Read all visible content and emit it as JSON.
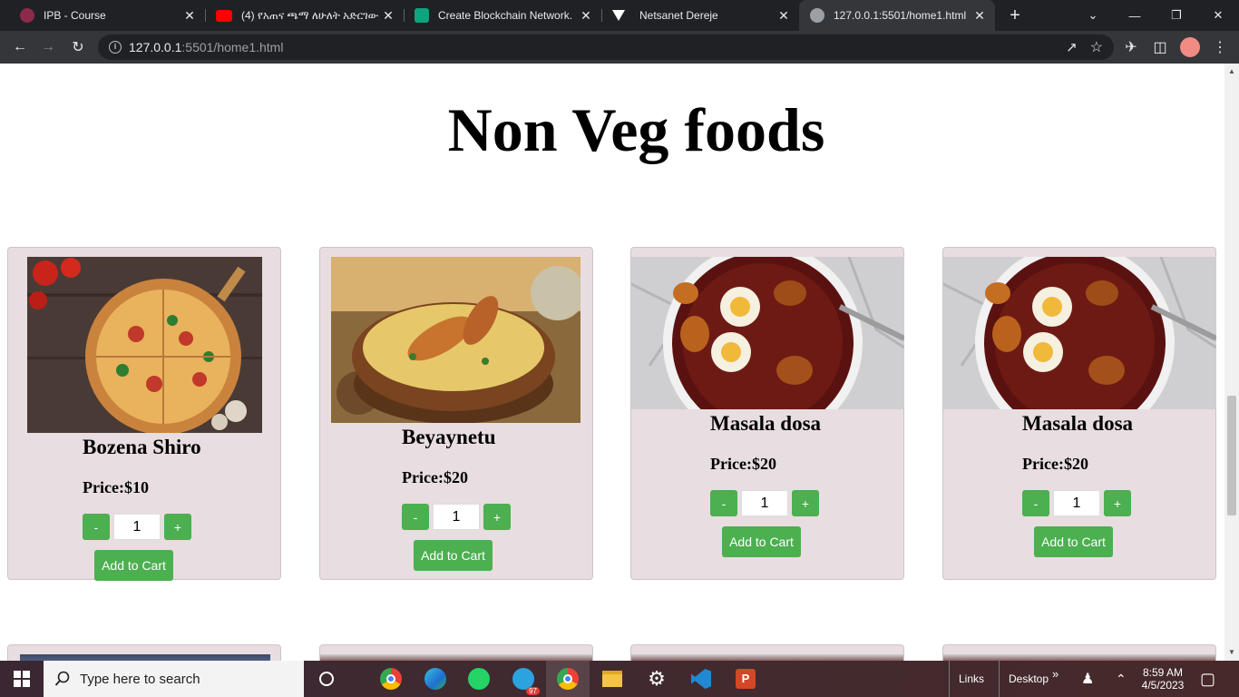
{
  "browser": {
    "tabs": [
      {
        "title": "IPB - Course",
        "icon": "ipb-logo-icon",
        "color": "#8b2a4a",
        "close": "✕"
      },
      {
        "title": "(4) የአጠና ጫማ ለሁለት አድርገው",
        "icon": "youtube-icon",
        "color": "#ff0000",
        "close": "✕"
      },
      {
        "title": "Create Blockchain Network.",
        "icon": "chatgpt-icon",
        "color": "#10a37f",
        "close": "✕"
      },
      {
        "title": "Netsanet Dereje",
        "icon": "vercel-icon",
        "color": "#ffffff",
        "close": "✕"
      },
      {
        "title": "127.0.0.1:5501/home1.html",
        "icon": "globe-icon",
        "color": "#9aa0a6",
        "close": "✕"
      }
    ],
    "new_tab": "+",
    "url_host": "127.0.0.1",
    "url_rest": ":5501/home1.html"
  },
  "page": {
    "heading": "Non Veg foods",
    "products": [
      {
        "name": "Bozena Shiro",
        "price": "Price:$10",
        "qty": "1",
        "minus": "-",
        "plus": "+",
        "cart": "Add to Cart",
        "image": "pizza-image"
      },
      {
        "name": "Beyaynetu",
        "price": "Price:$20",
        "qty": "1",
        "minus": "-",
        "plus": "+",
        "cart": "Add to Cart",
        "image": "biryani-image"
      },
      {
        "name": "Masala dosa",
        "price": "Price:$20",
        "qty": "1",
        "minus": "-",
        "plus": "+",
        "cart": "Add to Cart",
        "image": "doro-wat-image"
      },
      {
        "name": "Masala dosa",
        "price": "Price:$20",
        "qty": "1",
        "minus": "-",
        "plus": "+",
        "cart": "Add to Cart",
        "image": "doro-wat-image"
      }
    ]
  },
  "taskbar": {
    "search_placeholder": "Type here to search",
    "links": "Links",
    "desktop": "Desktop",
    "chevron": "»",
    "time": "8:59 AM",
    "date": "4/5/2023",
    "telegram_badge": "97"
  }
}
